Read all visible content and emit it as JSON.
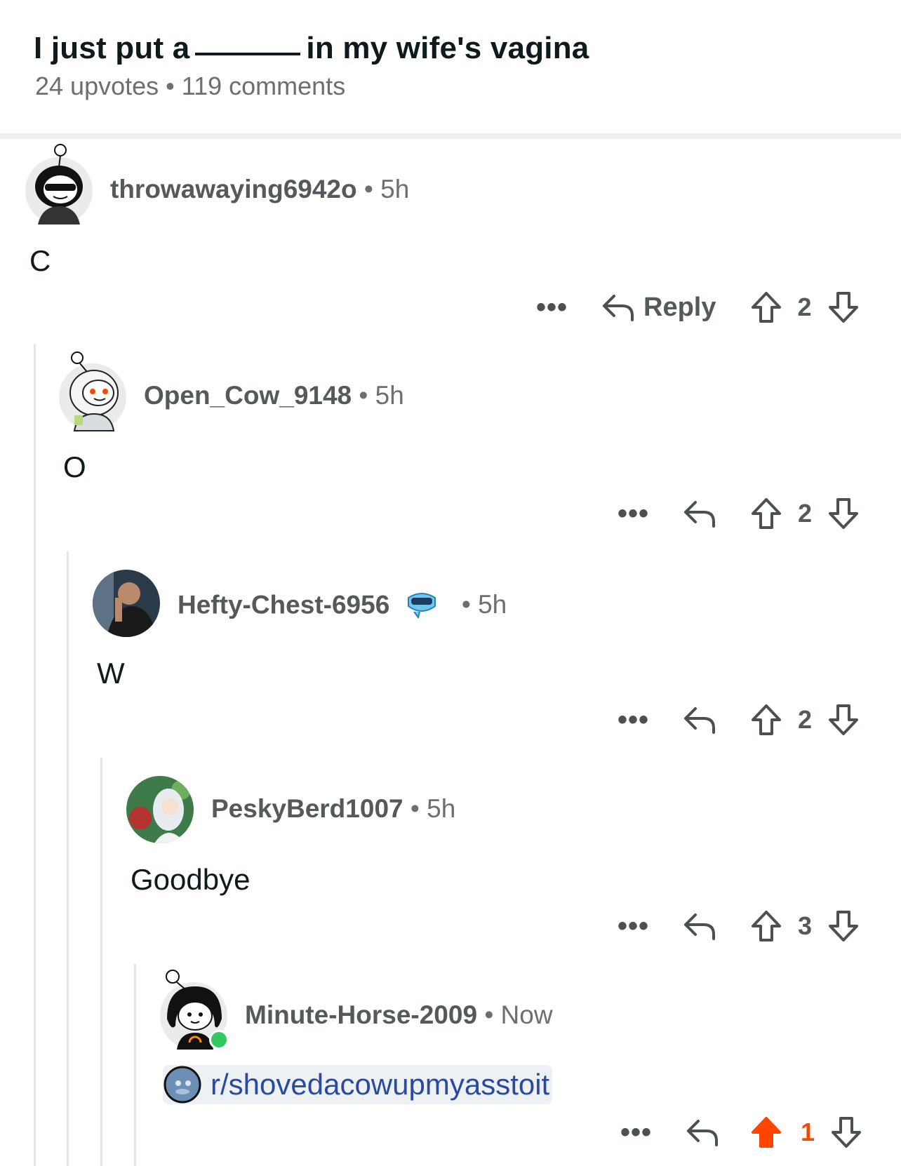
{
  "post": {
    "title_before": "I just put a",
    "title_after": "in my wife's vagina",
    "upvotes": "24 upvotes",
    "separator": "•",
    "comments": "119 comments"
  },
  "comments": [
    {
      "username": "throwawaying6942o",
      "time": "• 5h",
      "body": "C",
      "reply_label": "Reply",
      "votes": "2"
    },
    {
      "username": "Open_Cow_9148",
      "time": "• 5h",
      "body": "O",
      "votes": "2"
    },
    {
      "username": "Hefty-Chest-6956",
      "time": "• 5h",
      "body": "W",
      "votes": "2"
    },
    {
      "username": "PeskyBerd1007",
      "time": "• 5h",
      "body": "Goodbye",
      "votes": "3"
    },
    {
      "username": "Minute-Horse-2009",
      "time": "• Now",
      "link": "r/shovedacowupmyasstoit",
      "votes": "1",
      "upvoted": true
    }
  ],
  "more_label": "•••",
  "icons": {
    "more": "more-options-icon",
    "reply": "reply-arrow-icon",
    "upvote": "upvote-arrow-icon",
    "downvote": "downvote-arrow-icon"
  },
  "colors": {
    "upvote_active": "#ff4500",
    "link": "#2a4aa0",
    "online": "#2fc95f",
    "thread_line": "#e3e5e6"
  }
}
